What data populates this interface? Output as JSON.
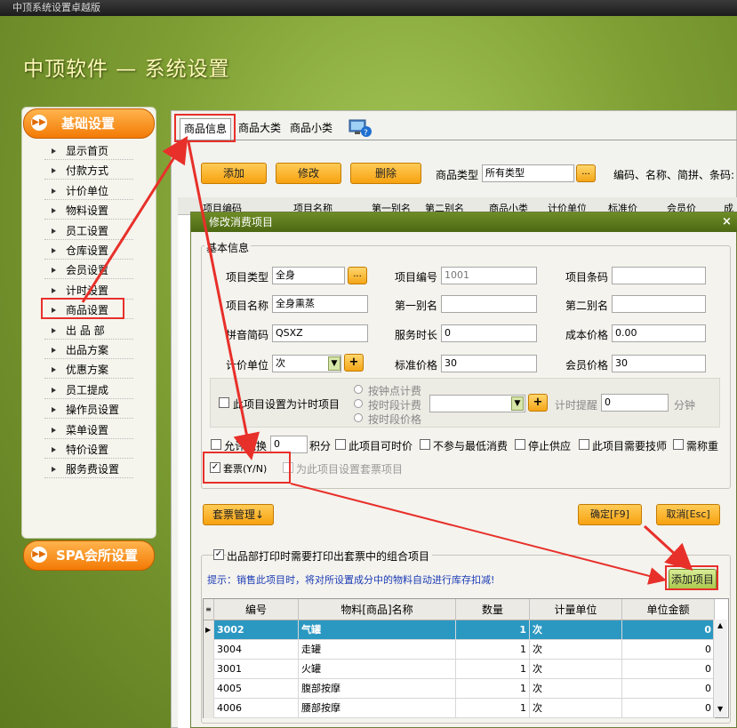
{
  "window": {
    "title": "中顶系统设置卓越版"
  },
  "app": {
    "title": "中顶软件 — 系统设置"
  },
  "sidebar": {
    "section_basic": "基础设置",
    "section_spa": "SPA会所设置",
    "items": [
      "显示首页",
      "付款方式",
      "计价单位",
      "物料设置",
      "员工设置",
      "仓库设置",
      "会员设置",
      "计时设置",
      "商品设置",
      "出 品 部",
      "出品方案",
      "优惠方案",
      "员工提成",
      "操作员设置",
      "菜单设置",
      "特价设置",
      "服务费设置"
    ]
  },
  "tabs": [
    "商品信息",
    "商品大类",
    "商品小类"
  ],
  "toolbar": {
    "add": "添加",
    "edit": "修改",
    "delete": "删除",
    "type_label": "商品类型",
    "type_value": "所有类型",
    "dots": "...",
    "search_label": "编码、名称、简拼、条码:"
  },
  "bg_grid": {
    "headers": [
      "项目编码",
      "项目名称",
      "第一别名",
      "第二别名",
      "商品小类",
      "计价单位",
      "标准价",
      "会员价",
      "成"
    ]
  },
  "dialog": {
    "title": "修改消费项目",
    "close": "×",
    "group_basic": "基本信息",
    "fields": {
      "type_label": "项目类型",
      "type_value": "全身",
      "code_label": "项目编号",
      "code_value": "1001",
      "barcode_label": "项目条码",
      "barcode_value": "",
      "name_label": "项目名称",
      "name_value": "全身熏蒸",
      "alias1_label": "第一别名",
      "alias1_value": "",
      "alias2_label": "第二别名",
      "alias2_value": "",
      "pinyin_label": "拼音简码",
      "pinyin_value": "QSXZ",
      "duration_label": "服务时长",
      "duration_value": "0",
      "cost_label": "成本价格",
      "cost_value": "0.00",
      "unit_label": "计价单位",
      "unit_value": "次",
      "price_label": "标准价格",
      "price_value": "30",
      "member_label": "会员价格",
      "member_value": "30"
    },
    "timing": {
      "checkbox": "此项目设置为计时项目",
      "radio1": "按钟点计费",
      "radio2": "按时段计费",
      "radio3": "按时段价格",
      "reminder_label": "计时提醒",
      "reminder_value": "0",
      "reminder_unit": "分钟"
    },
    "options": {
      "redeem": "允许兑换",
      "redeem_value": "0",
      "points": "积分",
      "timed_price": "此项目可时价",
      "no_min": "不参与最低消费",
      "stop": "停止供应",
      "need_tech": "此项目需要技师",
      "need_weigh": "需称重"
    },
    "package": {
      "checkbox": "套票(Y/N)",
      "hint": "为此项目设置套票项目"
    },
    "buttons": {
      "package_mgr": "套票管理↓",
      "ok": "确定[F9]",
      "cancel": "取消[Esc]",
      "add_item": "添加项目"
    },
    "combo_check": "出品部打印时需要打印出套票中的组合项目",
    "tip": "提示：销售此项目时，将对所设置成分中的物料自动进行库存扣减!",
    "table": {
      "headers": [
        "编号",
        "物料[商品]名称",
        "数量",
        "计量单位",
        "单位金额"
      ],
      "rows": [
        [
          "3002",
          "气罐",
          "1",
          "次",
          "0"
        ],
        [
          "3004",
          "走罐",
          "1",
          "次",
          "0"
        ],
        [
          "3001",
          "火罐",
          "1",
          "次",
          "0"
        ],
        [
          "4005",
          "腹部按摩",
          "1",
          "次",
          "0"
        ],
        [
          "4006",
          "腰部按摩",
          "1",
          "次",
          "0"
        ]
      ]
    }
  },
  "colors": {
    "accent": "#f7a10f",
    "annotation": "#e8302a",
    "selection": "#2b98c2",
    "titlebar": "#4c6813"
  }
}
